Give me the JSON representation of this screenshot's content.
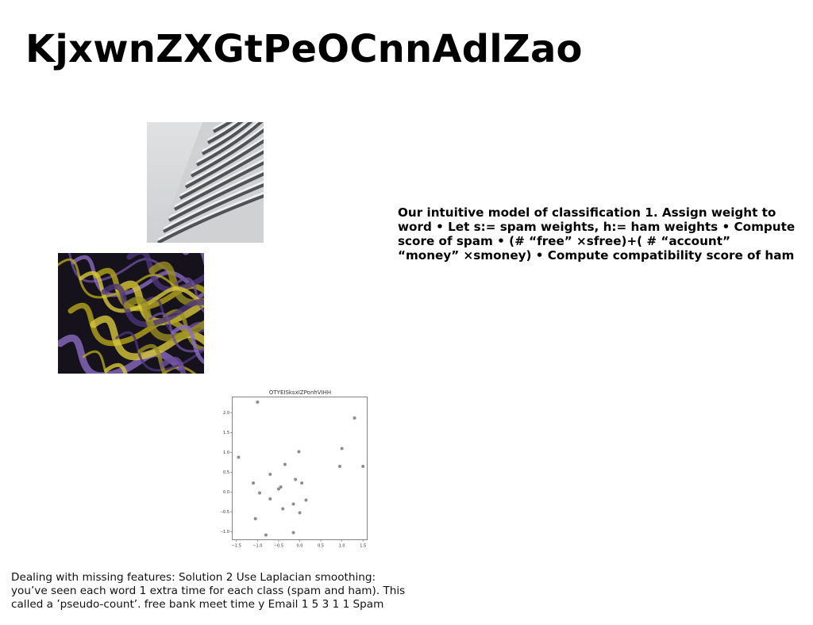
{
  "slide": {
    "title": "KjxwnZXGtPeOCnnAdlZao",
    "body_lines": [
      "Our intuitive model of classification 1. Assign weight to",
      "word • Let s:= spam weights, h:= ham weights • Compute",
      "score of spam • (# “free” ×sfree)+( # “account”",
      "“money” ×smoney) • Compute compatibility score of ham"
    ],
    "caption_lines": [
      "Dealing with missing features: Solution 2 Use Laplacian smoothing:",
      "you’ve seen each word 1 extra time for each class (spam and ham). This",
      "called a ’pseudo-count’. free bank meet time y Email 1 5 3 1 1 Spam"
    ]
  },
  "images": {
    "building": "architecture-facade-photo",
    "swirl": "purple-yellow-abstract-swirl-photo"
  },
  "chart_data": {
    "type": "scatter",
    "title": "OTYEISksxIZPonhVIHH",
    "xlabel": "",
    "ylabel": "",
    "xlim": [
      -1.6,
      1.6
    ],
    "ylim": [
      -1.2,
      2.4
    ],
    "xticks": [
      -1.5,
      -1.0,
      -0.5,
      0.0,
      0.5,
      1.0,
      1.5
    ],
    "yticks": [
      -1.0,
      -0.5,
      0.0,
      0.5,
      1.0,
      1.5,
      2.0
    ],
    "xtick_labels": [
      "−1.5",
      "−1.0",
      "−0.5",
      "0.0",
      "0.5",
      "1.0",
      "1.5"
    ],
    "ytick_labels": [
      "−1.0",
      "−0.5",
      "0.0",
      "0.5",
      "1.0",
      "1.5",
      "2.0"
    ],
    "grid": false,
    "marker_color": "#808080",
    "x": [
      -1.45,
      -1.0,
      1.3,
      1.0,
      -0.02,
      -0.35,
      0.95,
      1.5,
      -0.7,
      -0.1,
      -1.1,
      -0.45,
      0.05,
      -0.95,
      -0.5,
      -0.7,
      0.15,
      -0.15,
      -0.4,
      0.0,
      -1.05,
      -0.15,
      -0.8
    ],
    "y": [
      0.88,
      2.27,
      1.87,
      1.1,
      1.02,
      0.7,
      0.65,
      0.65,
      0.45,
      0.32,
      0.23,
      0.13,
      0.23,
      -0.02,
      0.08,
      -0.17,
      -0.2,
      -0.3,
      -0.42,
      -0.52,
      -0.67,
      -1.02,
      -1.08
    ]
  }
}
